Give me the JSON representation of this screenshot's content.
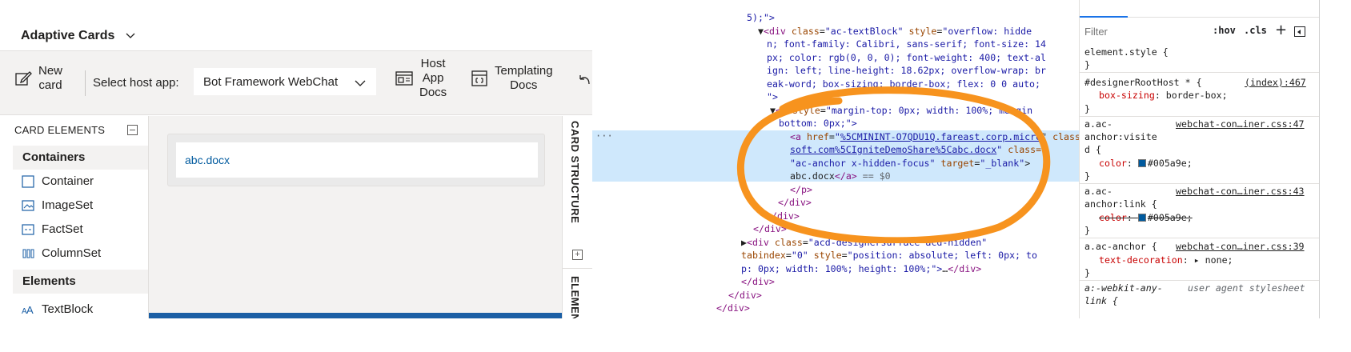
{
  "designer": {
    "app_title": "Adaptive Cards",
    "toolbar": {
      "new_card_line1": "New",
      "new_card_line2": "card",
      "host_label": "Select host app:",
      "host_value": "Bot Framework WebChat",
      "host_app_docs_line1": "Host",
      "host_app_docs_line2": "App",
      "host_app_docs_line3": "Docs",
      "templating_docs_line1": "Templating",
      "templating_docs_line2": "Docs"
    },
    "elements_panel": {
      "header": "CARD ELEMENTS",
      "containers_header": "Containers",
      "elements_header": "Elements",
      "containers": [
        "Container",
        "ImageSet",
        "FactSet",
        "ColumnSet"
      ],
      "elements": [
        "TextBlock"
      ]
    },
    "canvas": {
      "card_link_text": "abc.docx"
    },
    "vtabs": {
      "card_structure": "CARD STRUCTURE",
      "elements": "ELEMENTS"
    }
  },
  "devtools": {
    "tree": {
      "l1": "5);\">",
      "l2_tag": "div",
      "l2_attr1": "class",
      "l2_val1": "ac-textBlock",
      "l2_attr2": "style",
      "l2_val2a": "overflow: hidde",
      "l3": "n; font-family: Calibri, sans-serif; font-size: 14",
      "l4": "px; color: rgb(0, 0, 0); font-weight: 400; text-al",
      "l5": "ign: left; line-height: 18.62px; overflow-wrap: br",
      "l6": "eak-word; box-sizing: border-box; flex: 0 0 auto;",
      "l7": "\">",
      "l8_tag": "p",
      "l8_attr": "style",
      "l8_val": "margin-top: 0px; width: 100%; margin",
      "l9": "bottom: 0px;\">",
      "l10_tag": "a",
      "l10_attr": "href",
      "l10_val": "%5CMININT-O7QDU1Q.fareast.corp.micro",
      "l10_attr2": "class=",
      "l11_val": "soft.com%5CIgniteDemoShare%5Cabc.docx",
      "l11_attr": "class=",
      "l12_val": "ac-anchor x-hidden-focus",
      "l12_attr": "target",
      "l12_val2": "_blank",
      "l13_text": "abc.docx",
      "l13_close": "a",
      "l13_eq": "== $0",
      "l14": "p",
      "l15": "div",
      "l16": "div",
      "l17": "div",
      "l18_tag": "div",
      "l18_attr": "class",
      "l18_val": "acd-designersurface acd-hidden",
      "l19_attr": "tabindex",
      "l19_val": "0",
      "l19_attr2": "style",
      "l19_val2": "position: absolute; left: 0px; to",
      "l20": "p: 0px; width: 100%; height: 100%;\">",
      "l20_ellipsis": "…",
      "l20_close": "div",
      "l21": "div",
      "l22": "div",
      "l23": "div"
    },
    "styles": {
      "filter_placeholder": "Filter",
      "hov": ":hov",
      "cls": ".cls",
      "plus": "+",
      "element_style": "element.style {",
      "brace_close": "}",
      "r1_selector": "#designerRootHost * {",
      "r1_source": "(index):467",
      "r1_prop": "box-sizing",
      "r1_value": "border-box;",
      "r2_selector_a": "a.ac-",
      "r2_selector_b": "anchor:visite",
      "r2_selector_c": "d {",
      "r2_source": "webchat-con…iner.css:47",
      "r2_prop": "color",
      "r2_value": "#005a9e;",
      "r3_selector_a": "a.ac-",
      "r3_selector_b": "anchor:link {",
      "r3_source": "webchat-con…iner.css:43",
      "r3_prop": "color",
      "r3_value": "#005a9e;",
      "r4_selector": "a.ac-anchor {",
      "r4_source": "webchat-con…iner.css:39",
      "r4_prop": "text-decoration",
      "r4_value": "none;",
      "r5_selector": "a:-webkit-any-",
      "r5_selector_b": "link {",
      "r5_source": "user agent stylesheet"
    }
  },
  "colors": {
    "accent": "#005a9e",
    "selection": "#cfe8fc",
    "annotation": "#f7931e"
  }
}
